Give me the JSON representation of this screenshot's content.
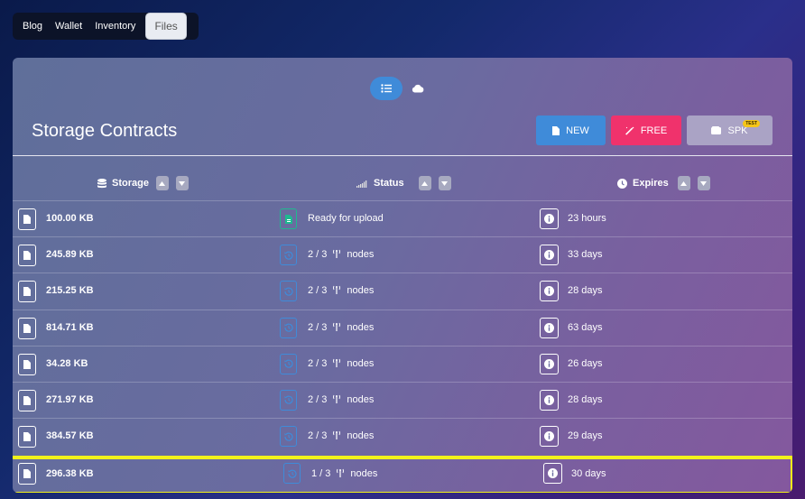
{
  "nav": {
    "tabs": [
      {
        "label": "Blog"
      },
      {
        "label": "Wallet"
      },
      {
        "label": "Inventory"
      },
      {
        "label": "Files",
        "active": true
      }
    ]
  },
  "panel": {
    "title": "Storage Contracts",
    "view_toggle": {
      "list_icon": "list-icon",
      "cloud_icon": "cloud-icon"
    },
    "actions": {
      "new_label": "NEW",
      "free_label": "FREE",
      "spk_label": "SPK",
      "spk_badge": "TEST"
    },
    "columns": {
      "storage": "Storage",
      "status": "Status",
      "expires": "Expires"
    },
    "rows": [
      {
        "size": "100.00 KB",
        "status": "Ready for upload",
        "status_type": "ready",
        "expires": "23 hours"
      },
      {
        "size": "245.89 KB",
        "status": "2 / 3",
        "nodes": "nodes",
        "status_type": "nodes",
        "expires": "33 days"
      },
      {
        "size": "215.25 KB",
        "status": "2 / 3",
        "nodes": "nodes",
        "status_type": "nodes",
        "expires": "28 days"
      },
      {
        "size": "814.71 KB",
        "status": "2 / 3",
        "nodes": "nodes",
        "status_type": "nodes",
        "expires": "63 days"
      },
      {
        "size": "34.28 KB",
        "status": "2 / 3",
        "nodes": "nodes",
        "status_type": "nodes",
        "expires": "26 days"
      },
      {
        "size": "271.97 KB",
        "status": "2 / 3",
        "nodes": "nodes",
        "status_type": "nodes",
        "expires": "28 days"
      },
      {
        "size": "384.57 KB",
        "status": "2 / 3",
        "nodes": "nodes",
        "status_type": "nodes",
        "expires": "29 days"
      },
      {
        "size": "296.38 KB",
        "status": "1 / 3",
        "nodes": "nodes",
        "status_type": "nodes",
        "expires": "30 days",
        "selected": true
      }
    ]
  },
  "colors": {
    "accent_blue": "#3f8bd9",
    "free_pink": "#f0326c",
    "spk_gray": "#aaa3c5",
    "ready_green": "#1fb990",
    "selection_yellow": "#f2f21a"
  }
}
